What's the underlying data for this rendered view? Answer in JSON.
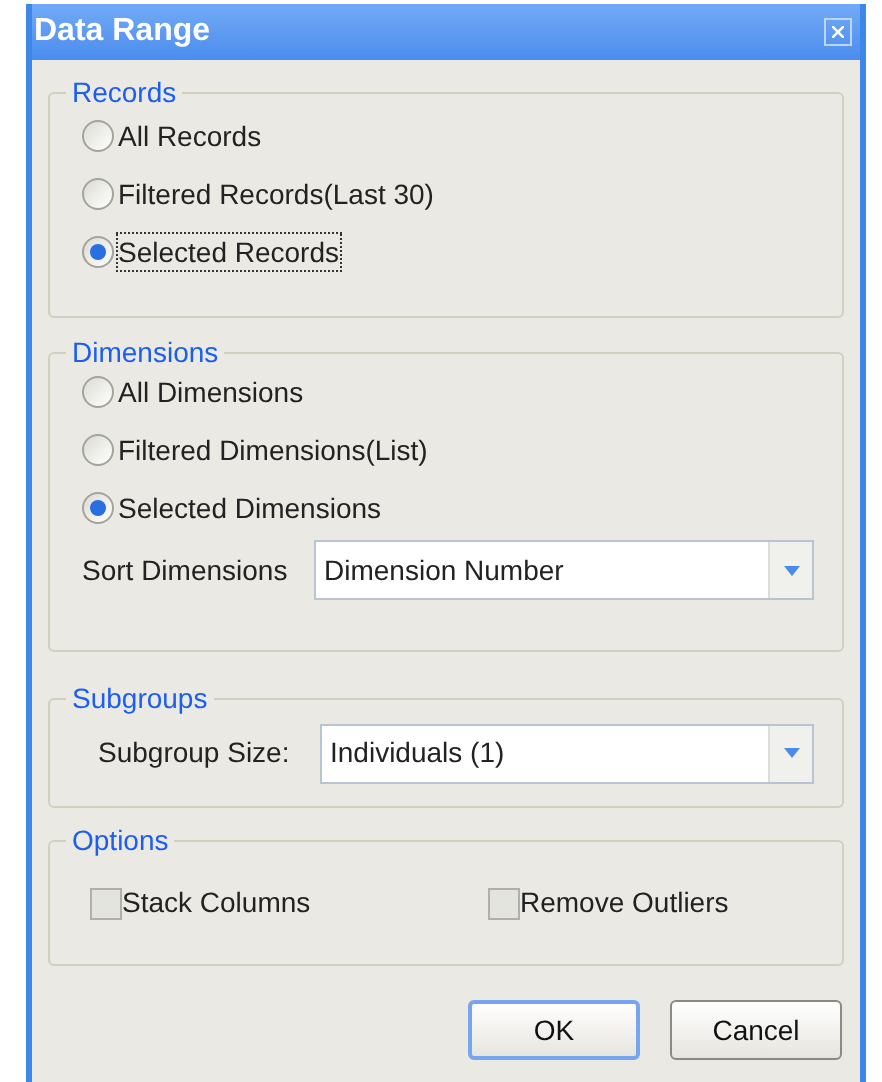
{
  "window": {
    "title": "Data Range"
  },
  "records": {
    "title": "Records",
    "options": [
      {
        "label": "All Records",
        "selected": false
      },
      {
        "label": "Filtered Records(Last 30)",
        "selected": false
      },
      {
        "label": "Selected Records",
        "selected": true
      }
    ]
  },
  "dimensions": {
    "title": "Dimensions",
    "options": [
      {
        "label": "All Dimensions",
        "selected": false
      },
      {
        "label": "Filtered Dimensions(List)",
        "selected": false
      },
      {
        "label": "Selected Dimensions",
        "selected": true
      }
    ],
    "sort": {
      "label": "Sort Dimensions",
      "value": "Dimension Number"
    }
  },
  "subgroups": {
    "title": "Subgroups",
    "size": {
      "label": "Subgroup Size:",
      "value": "Individuals (1)"
    }
  },
  "options": {
    "title": "Options",
    "items": [
      {
        "label": "Stack Columns",
        "checked": false
      },
      {
        "label": "Remove Outliers",
        "checked": false
      }
    ]
  },
  "buttons": [
    {
      "label": "OK",
      "default": true
    },
    {
      "label": "Cancel",
      "default": false
    }
  ]
}
